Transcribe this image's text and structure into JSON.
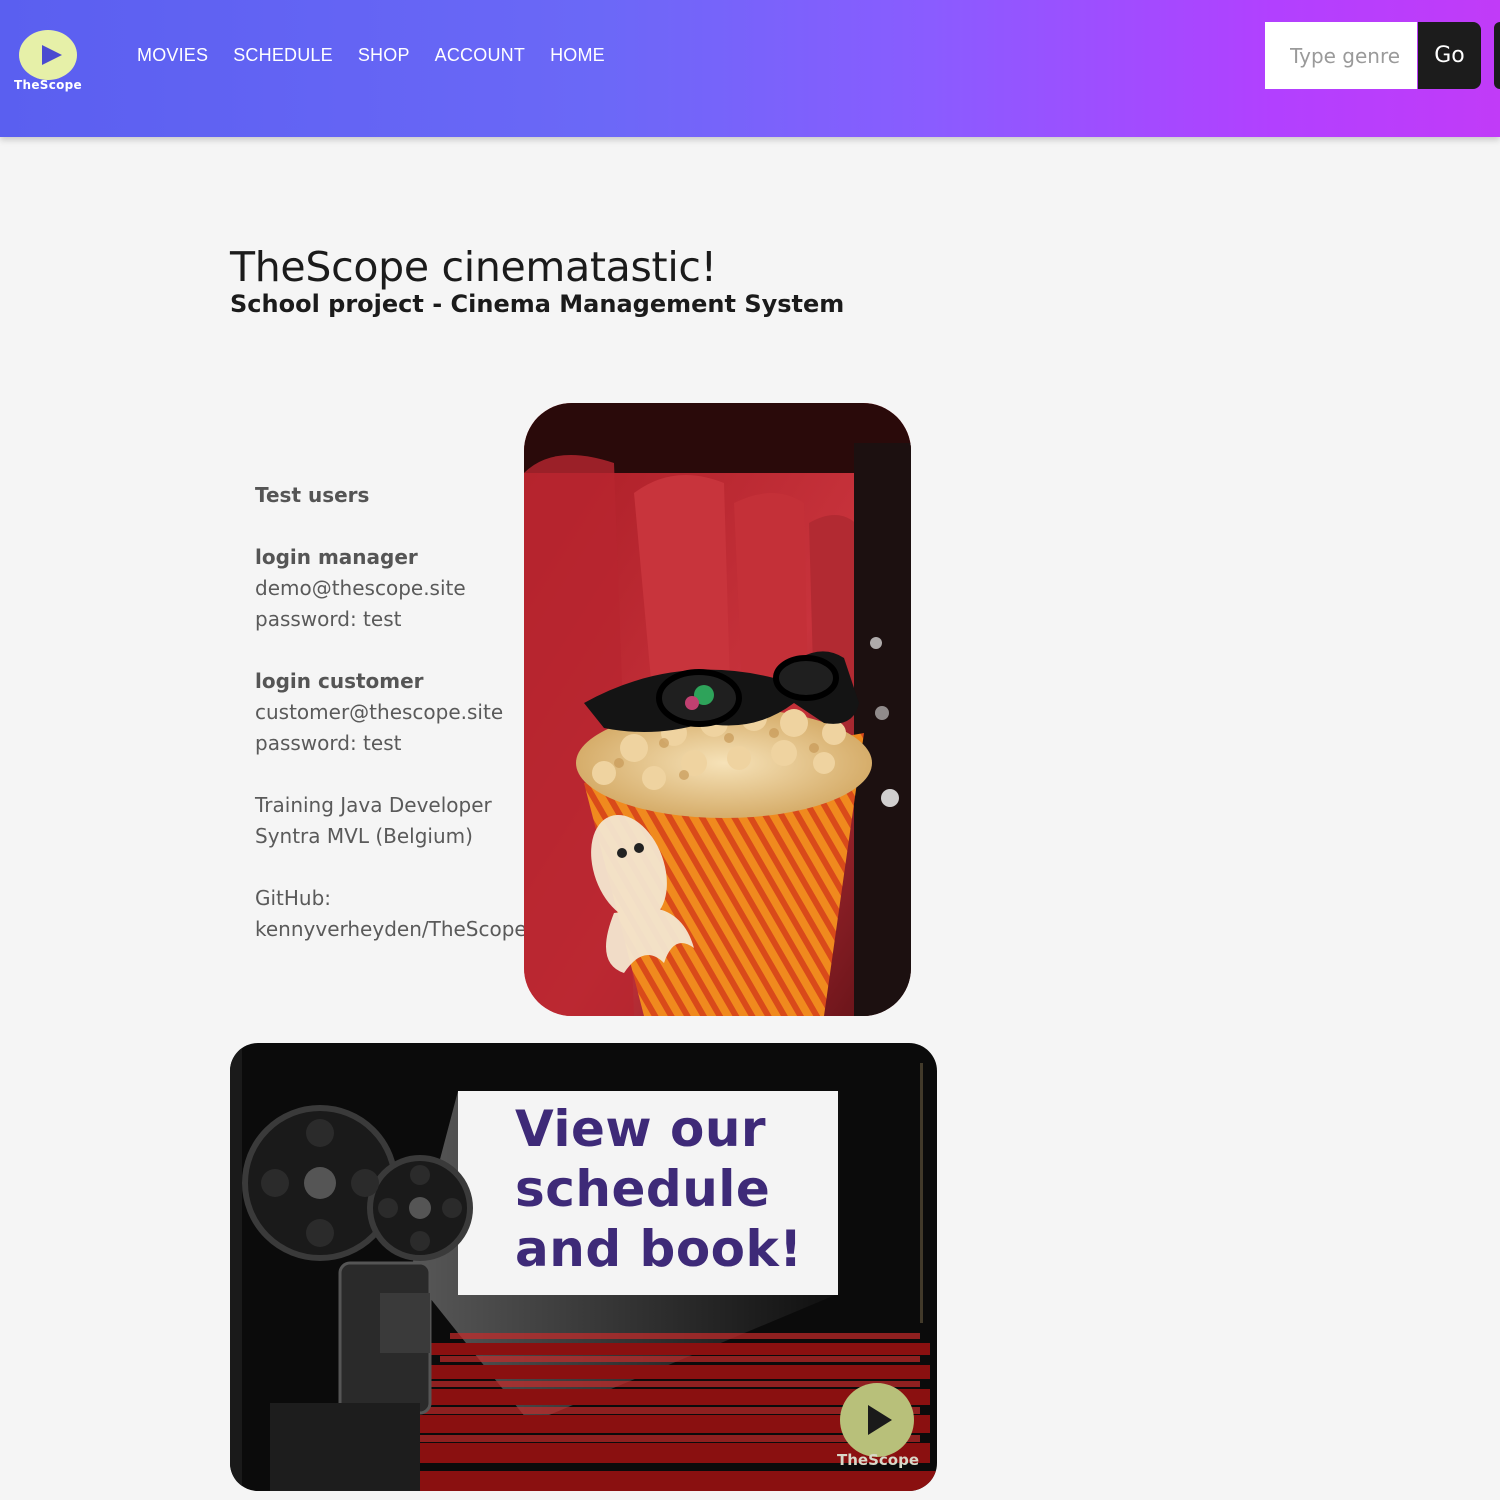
{
  "brand": {
    "logo_text": "TheScope"
  },
  "nav": {
    "items": [
      {
        "label": "MOVIES"
      },
      {
        "label": "SCHEDULE"
      },
      {
        "label": "SHOP"
      },
      {
        "label": "ACCOUNT"
      },
      {
        "label": "HOME"
      }
    ]
  },
  "search": {
    "placeholder": "Type genre",
    "value": "",
    "button_label": "Go"
  },
  "hero": {
    "title": "TheScope cinematastic!",
    "subtitle": "School project - Cinema Management System"
  },
  "info": {
    "heading": "Test users",
    "manager": {
      "label": "login manager",
      "email": "demo@thescope.site",
      "password": "password: test"
    },
    "customer": {
      "label": "login customer",
      "email": "customer@thescope.site",
      "password": "password: test"
    },
    "training": {
      "line1": "Training Java Developer",
      "line2": "Syntra MVL (Belgium)"
    },
    "github": {
      "label": "GitHub:",
      "repo": "kennyverheyden/TheScope"
    }
  },
  "banner": {
    "line1": "View our",
    "line2": "schedule",
    "line3": "and book!",
    "logo_text": "TheScope"
  },
  "colors": {
    "accent": "#6b68f7",
    "gradient_end": "#c13bf8",
    "banner_text": "#3e2a78",
    "logo_circle": "#e6f0a8"
  }
}
